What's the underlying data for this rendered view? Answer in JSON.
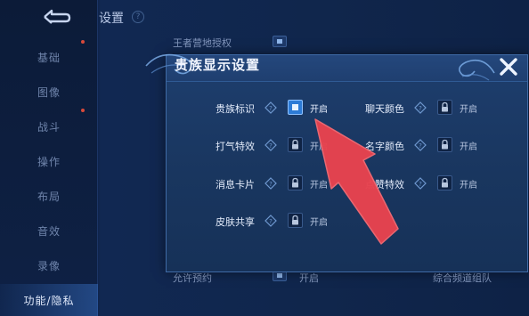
{
  "background": {
    "back_icon": "back-arrow-icon",
    "settings_title": "设置",
    "help_glyph": "?",
    "sidebar": [
      {
        "label": "基础"
      },
      {
        "label": "图像"
      },
      {
        "label": "战斗"
      },
      {
        "label": "操作"
      },
      {
        "label": "布局"
      },
      {
        "label": "音效"
      },
      {
        "label": "录像"
      },
      {
        "label": "功能/隐私"
      }
    ],
    "active_item": "功能/隐私",
    "rows": {
      "top_label": "王者营地授权",
      "bottom_label": "允许预约",
      "bottom_state": "开启",
      "bottom_right": "综合频道组队"
    }
  },
  "modal": {
    "title": "贵族显示设置",
    "close_icon": "close-x-icon",
    "options": [
      {
        "label": "贵族标识",
        "state": "开启",
        "enabled": true
      },
      {
        "label": "聊天颜色",
        "state": "开启",
        "enabled": false
      },
      {
        "label": "打气特效",
        "state": "开启",
        "enabled": false
      },
      {
        "label": "名字颜色",
        "state": "开启",
        "enabled": false
      },
      {
        "label": "消息卡片",
        "state": "开启",
        "enabled": false
      },
      {
        "label": "点赞特效",
        "state": "开启",
        "enabled": false
      },
      {
        "label": "皮肤共享",
        "state": "开启",
        "enabled": false
      }
    ]
  },
  "colors": {
    "accent": "#2d7bd6",
    "arrow": "#e8434f",
    "panel": "#1b3963"
  }
}
